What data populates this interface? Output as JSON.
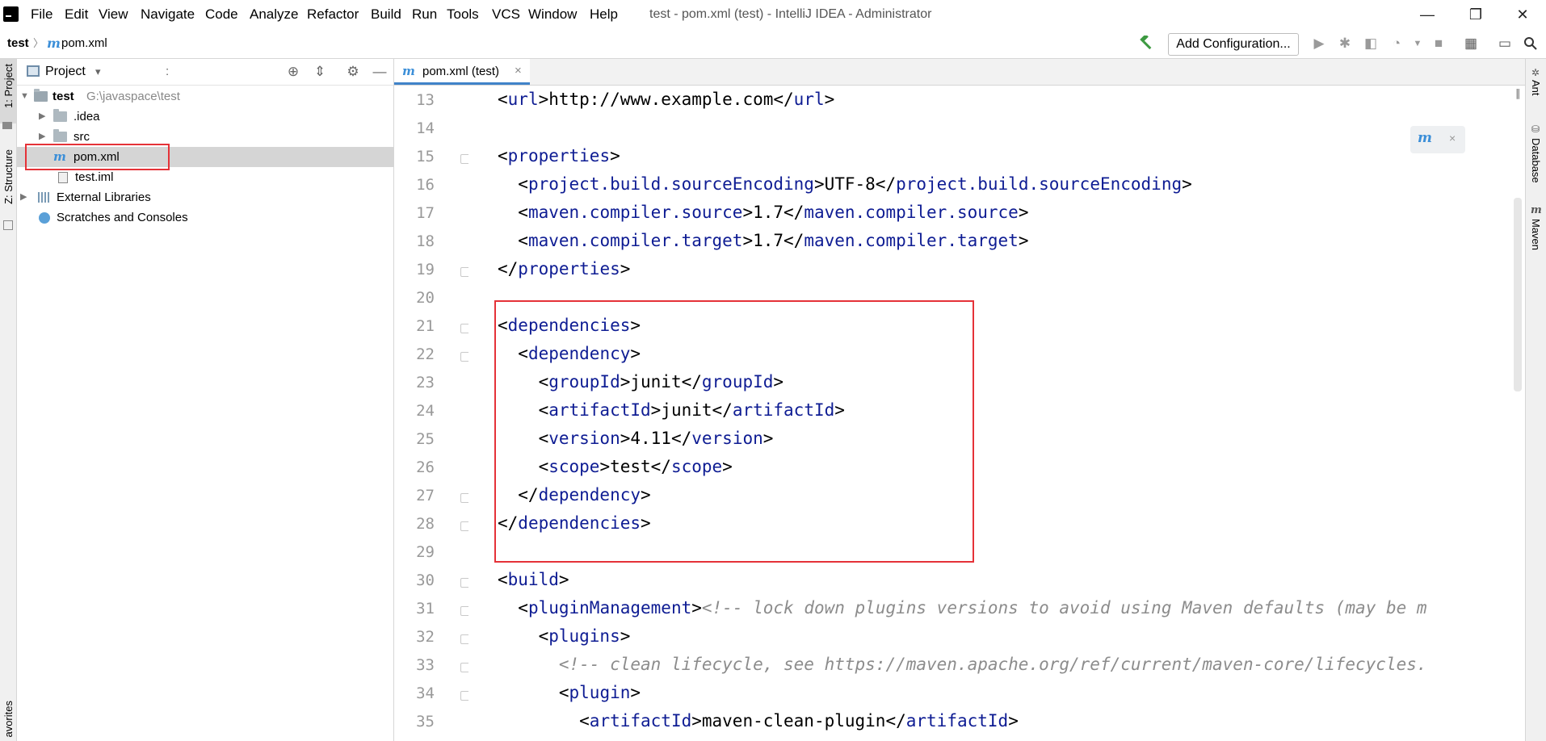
{
  "window": {
    "title": "test - pom.xml (test) - IntelliJ IDEA - Administrator",
    "menu": [
      "File",
      "Edit",
      "View",
      "Navigate",
      "Code",
      "Analyze",
      "Refactor",
      "Build",
      "Run",
      "Tools",
      "VCS",
      "Window",
      "Help"
    ],
    "minimize": "—",
    "restore": "❐",
    "close": "✕"
  },
  "navbar": {
    "project": "test",
    "separator": "〉",
    "file_icon": "m",
    "file": "pom.xml",
    "run_config": "Add Configuration..."
  },
  "left_strip": {
    "project_tab": "1: Project",
    "structure_tab": "Z: Structure",
    "favorites_tab": "avorites"
  },
  "project_panel": {
    "title": "Project",
    "dropdown": "▾",
    "colon": ":",
    "tree": [
      {
        "name": "test",
        "path": "G:\\javaspace\\test",
        "expanded": true
      },
      {
        "name": ".idea",
        "type": "folder"
      },
      {
        "name": "src",
        "type": "folder"
      },
      {
        "name": "pom.xml",
        "type": "maven",
        "selected": true
      },
      {
        "name": "test.iml",
        "type": "iml"
      },
      {
        "name": "External Libraries",
        "type": "libraries"
      },
      {
        "name": "Scratches and Consoles",
        "type": "scratches"
      }
    ]
  },
  "editor": {
    "tab_label": "pom.xml (test)",
    "tab_close": "×",
    "line_numbers": [
      "13",
      "14",
      "15",
      "16",
      "17",
      "18",
      "19",
      "20",
      "21",
      "22",
      "23",
      "24",
      "25",
      "26",
      "27",
      "28",
      "29",
      "30",
      "31",
      "32",
      "33",
      "34",
      "35"
    ],
    "lines": [
      "<url>http://www.example.com</url>",
      "",
      "<properties>",
      "  <project.build.sourceEncoding>UTF-8</project.build.sourceEncoding>",
      "  <maven.compiler.source>1.7</maven.compiler.source>",
      "  <maven.compiler.target>1.7</maven.compiler.target>",
      "</properties>",
      "",
      "<dependencies>",
      "  <dependency>",
      "    <groupId>junit</groupId>",
      "    <artifactId>junit</artifactId>",
      "    <version>4.11</version>",
      "    <scope>test</scope>",
      "  </dependency>",
      "</dependencies>",
      "",
      "<build>",
      "  <pluginManagement><!-- lock down plugins versions to avoid using Maven defaults (may be m",
      "    <plugins>",
      "      <!-- clean lifecycle, see https://maven.apache.org/ref/current/maven-core/lifecycles.",
      "      <plugin>",
      "        <artifactId>maven-clean-plugin</artifactId>"
    ]
  },
  "right_strip": {
    "tabs": [
      "Ant",
      "Database",
      "Maven"
    ]
  },
  "colors": {
    "xml_tag": "#0e1c93",
    "comment": "#8c8c8c",
    "highlight_box": "#e53238",
    "selection": "#d5d5d5"
  }
}
